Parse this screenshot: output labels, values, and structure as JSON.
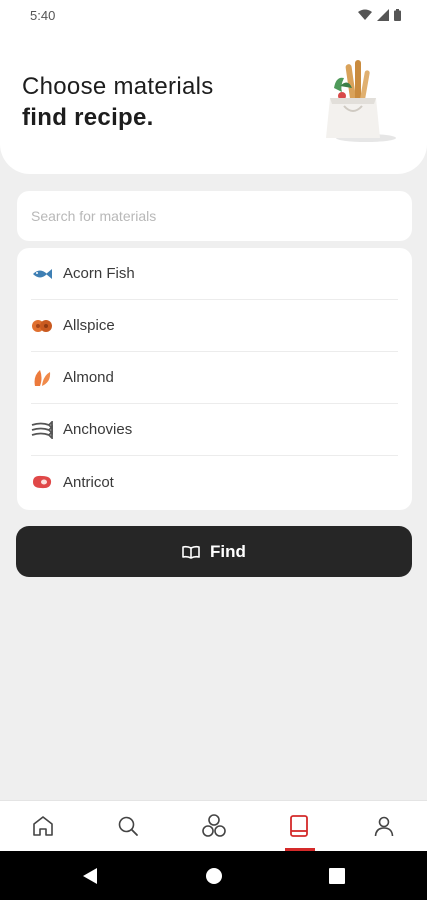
{
  "status_bar": {
    "time": "5:40",
    "icons": [
      "wifi-icon",
      "signal-icon",
      "battery-icon"
    ]
  },
  "header": {
    "title_line1": "Choose materials",
    "title_line2": "find recipe."
  },
  "search": {
    "placeholder": "Search for materials",
    "value": ""
  },
  "materials": [
    {
      "label": "Acorn Fish",
      "icon": "fish-icon"
    },
    {
      "label": "Allspice",
      "icon": "allspice-icon"
    },
    {
      "label": "Almond",
      "icon": "almond-icon"
    },
    {
      "label": "Anchovies",
      "icon": "anchovies-icon"
    },
    {
      "label": "Antricot",
      "icon": "steak-icon"
    }
  ],
  "find_button": {
    "label": "Find",
    "icon": "book-open-icon"
  },
  "bottom_nav": {
    "items": [
      {
        "name": "home",
        "icon": "home-icon",
        "active": false
      },
      {
        "name": "search",
        "icon": "search-icon",
        "active": false
      },
      {
        "name": "categories",
        "icon": "categories-icon",
        "active": false
      },
      {
        "name": "recipes",
        "icon": "book-icon",
        "active": true
      },
      {
        "name": "profile",
        "icon": "user-icon",
        "active": false
      }
    ],
    "active_color": "#d42a2a"
  },
  "colors": {
    "accent": "#d42a2a",
    "button_bg": "#262626",
    "background": "#efefef"
  }
}
